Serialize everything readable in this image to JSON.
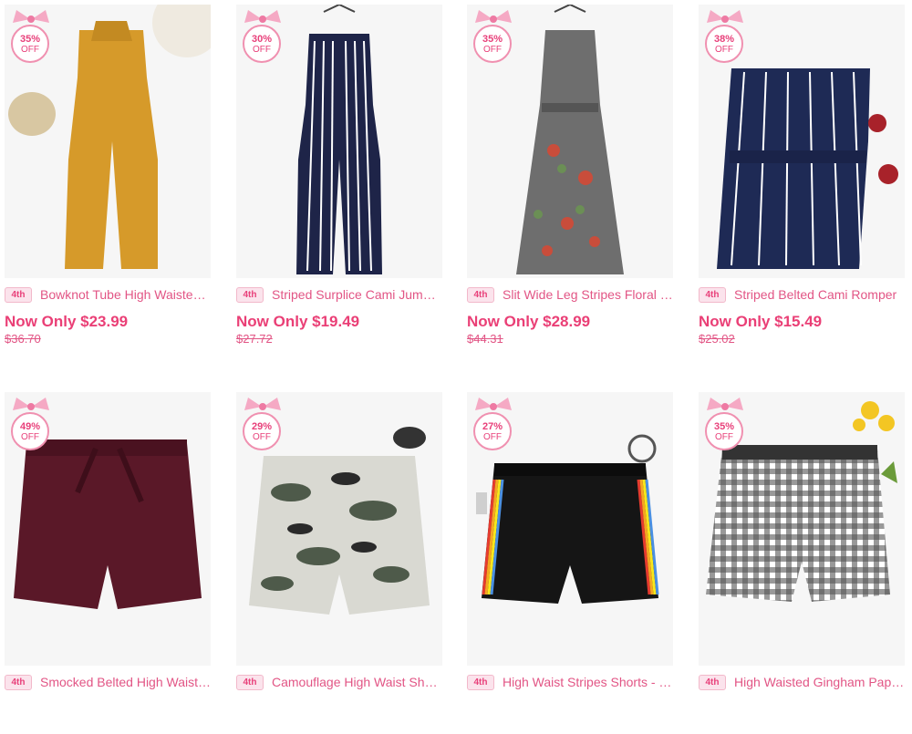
{
  "products": [
    {
      "badge_pct": "35%",
      "badge_off": "OFF",
      "tag": "4th",
      "title": "Bowknot Tube High Waisted Jumpsuit",
      "price": "Now Only $23.99",
      "old_price": "$36.70",
      "garment_color": "#d69a2a",
      "icon": "jumpsuit-icon"
    },
    {
      "badge_pct": "30%",
      "badge_off": "OFF",
      "tag": "4th",
      "title": "Striped Surplice Cami Jumpsuit",
      "price": "Now Only $19.49",
      "old_price": "$27.72",
      "garment_color": "#1e2448",
      "icon": "jumpsuit-icon"
    },
    {
      "badge_pct": "35%",
      "badge_off": "OFF",
      "tag": "4th",
      "title": "Slit Wide Leg Stripes Floral Jumpsuit",
      "price": "Now Only $28.99",
      "old_price": "$44.31",
      "garment_color": "#6e6e6e",
      "icon": "jumpsuit-icon"
    },
    {
      "badge_pct": "38%",
      "badge_off": "OFF",
      "tag": "4th",
      "title": "Striped Belted Cami Romper",
      "price": "Now Only $15.49",
      "old_price": "$25.02",
      "garment_color": "#1e2a55",
      "icon": "romper-icon"
    },
    {
      "badge_pct": "49%",
      "badge_off": "OFF",
      "tag": "4th",
      "title": "Smocked Belted High Waisted Shorts",
      "price": "",
      "old_price": "",
      "garment_color": "#5a1828",
      "icon": "shorts-icon"
    },
    {
      "badge_pct": "29%",
      "badge_off": "OFF",
      "tag": "4th",
      "title": "Camouflage High Waist Shorts",
      "price": "",
      "old_price": "",
      "garment_color": "#8a8f86",
      "icon": "shorts-icon"
    },
    {
      "badge_pct": "27%",
      "badge_off": "OFF",
      "tag": "4th",
      "title": "High Waist Stripes Shorts - Black",
      "price": "",
      "old_price": "",
      "garment_color": "#151515",
      "icon": "shorts-icon"
    },
    {
      "badge_pct": "35%",
      "badge_off": "OFF",
      "tag": "4th",
      "title": "High Waisted Gingham Paperbag Shorts",
      "price": "",
      "old_price": "",
      "garment_color": "#333333",
      "icon": "shorts-icon"
    }
  ]
}
